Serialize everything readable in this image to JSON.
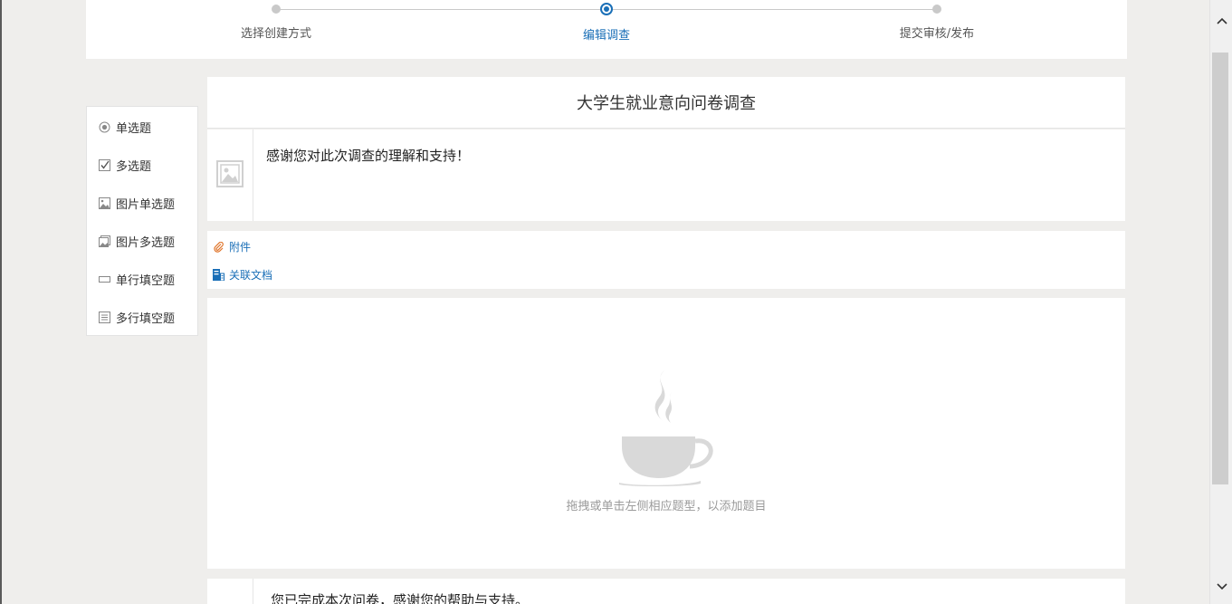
{
  "steps": [
    {
      "label": "选择创建方式",
      "state": "done"
    },
    {
      "label": "编辑调查",
      "state": "active"
    },
    {
      "label": "提交审核/发布",
      "state": "pending"
    }
  ],
  "palette": {
    "items": [
      {
        "label": "单选题",
        "icon": "radio-icon"
      },
      {
        "label": "多选题",
        "icon": "checkbox-icon"
      },
      {
        "label": "图片单选题",
        "icon": "image-icon"
      },
      {
        "label": "图片多选题",
        "icon": "multi-image-icon"
      },
      {
        "label": "单行填空题",
        "icon": "single-line-icon"
      },
      {
        "label": "多行填空题",
        "icon": "multi-line-icon"
      }
    ]
  },
  "survey": {
    "title": "大学生就业意向问卷调查",
    "intro": "感谢您对此次调查的理解和支持！",
    "attachment_label": "附件",
    "related_docs_label": "关联文档",
    "empty_hint": "拖拽或单击左侧相应题型，以添加题目",
    "closing": "您已完成本次问卷，感谢您的帮助与支持。"
  },
  "colors": {
    "accent": "#1a6fb7",
    "background": "#efeeec",
    "hint_text": "#9a9a9a"
  }
}
